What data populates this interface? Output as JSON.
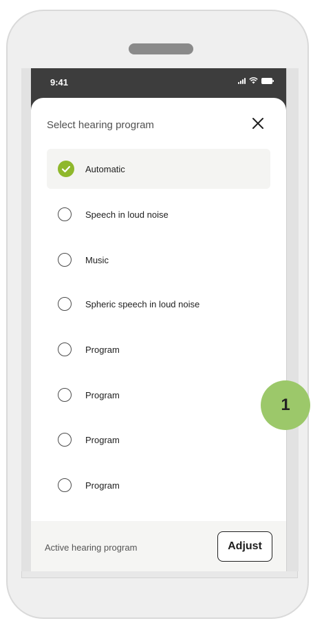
{
  "status_bar": {
    "time": "9:41"
  },
  "sheet": {
    "title": "Select hearing program",
    "close_icon": "close-icon"
  },
  "programs": [
    {
      "label": "Automatic",
      "selected": true
    },
    {
      "label": "Speech in loud noise",
      "selected": false
    },
    {
      "label": "Music",
      "selected": false
    },
    {
      "label": "Spheric speech in loud noise",
      "selected": false
    },
    {
      "label": "Program",
      "selected": false
    },
    {
      "label": "Program",
      "selected": false
    },
    {
      "label": "Program",
      "selected": false
    },
    {
      "label": "Program",
      "selected": false
    }
  ],
  "footer": {
    "label": "Active hearing program",
    "adjust_label": "Adjust"
  },
  "annotation": {
    "step_number": "1"
  },
  "colors": {
    "accent_green": "#8fb82c",
    "badge_green": "#9cc86a",
    "status_bar": "#3d3d3d"
  }
}
